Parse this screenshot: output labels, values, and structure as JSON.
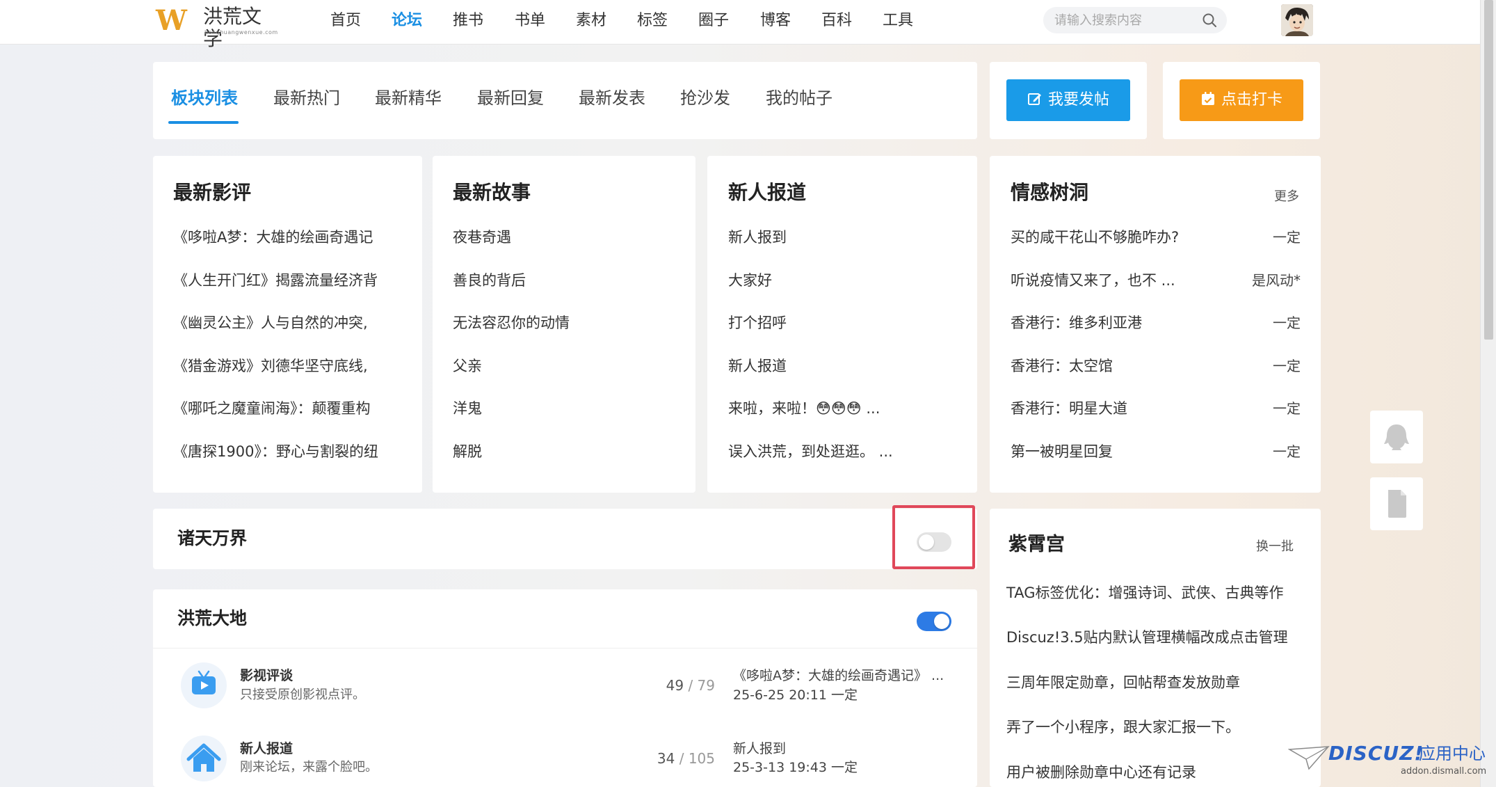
{
  "header": {
    "logo_mark": "W",
    "logo_name": "洪荒文学",
    "logo_sub": "honghuangwenxue.com",
    "nav": [
      "首页",
      "论坛",
      "推书",
      "书单",
      "素材",
      "标签",
      "圈子",
      "博客",
      "百科",
      "工具"
    ],
    "active_nav": "论坛",
    "search_placeholder": "请输入搜索内容"
  },
  "tabs": {
    "items": [
      "板块列表",
      "最新热门",
      "最新精华",
      "最新回复",
      "最新发表",
      "抢沙发",
      "我的帖子"
    ],
    "active": "板块列表"
  },
  "actions": {
    "post_label": "我要发帖",
    "checkin_label": "点击打卡",
    "post_color": "#1a9be8",
    "checkin_color": "#f79a17"
  },
  "blocks": [
    {
      "title": "最新影评",
      "items": [
        "《哆啦A梦：大雄的绘画奇遇记",
        "《人生开门红》揭露流量经济背",
        "《幽灵公主》人与自然的冲突,",
        "《猎金游戏》刘德华坚守底线,",
        "《哪吒之魔童闹海》：颠覆重构",
        "《唐探1900》：野心与割裂的纽"
      ]
    },
    {
      "title": "最新故事",
      "items": [
        "夜巷奇遇",
        "善良的背后",
        "无法容忍你的动情",
        "父亲",
        "洋鬼",
        "解脱"
      ]
    },
    {
      "title": "新人报道",
      "items": [
        "新人报到",
        "大家好",
        "打个招呼",
        "新人报道",
        "来啦，来啦！😳😳😳 ...",
        "误入洪荒，到处逛逛。 ..."
      ]
    },
    {
      "title": "情感树洞",
      "more": "更多",
      "items": [
        {
          "text": "买的咸干花山不够脆咋办?",
          "author": "一定"
        },
        {
          "text": "听说疫情又来了，也不 ...",
          "author": "是风动*"
        },
        {
          "text": "香港行：维多利亚港",
          "author": "一定"
        },
        {
          "text": "香港行：太空馆",
          "author": "一定"
        },
        {
          "text": "香港行：明星大道",
          "author": "一定"
        },
        {
          "text": "第一被明星回复",
          "author": "一定"
        }
      ]
    }
  ],
  "sections": [
    {
      "title": "诸天万界",
      "toggle_on": false
    },
    {
      "title": "洪荒大地",
      "toggle_on": true
    }
  ],
  "forums": [
    {
      "name": "影视评谈",
      "desc": "只接受原创影视点评。",
      "count": "49",
      "total": "79",
      "last_title": "《哆啦A梦：大雄的绘画奇遇记》 ...",
      "last_meta": "25-6-25 20:11 一定"
    },
    {
      "name": "新人报道",
      "desc": "刚来论坛，来露个脸吧。",
      "count": "34",
      "total": "105",
      "last_title": "新人报到",
      "last_meta": "25-3-13 19:43 一定"
    }
  ],
  "count_separator": "/",
  "sidebar": {
    "title": "紫霄宫",
    "refresh": "换一批",
    "items": [
      "TAG标签优化：增强诗词、武侠、古典等作",
      "Discuz!3.5贴内默认管理横幅改成点击管理",
      "三周年限定勋章，回帖帮查发放勋章",
      "弄了一个小程序，跟大家汇报一下。",
      "用户被删除勋章中心还有记录"
    ]
  },
  "watermark": {
    "brand": "DISCUZ!",
    "cn": "应用中心",
    "url": "addon.dismall.com"
  },
  "colors": {
    "accent": "#1a8fe3",
    "toggle_on": "#2d7be5",
    "toggle_off": "#e4e4e4",
    "highlight_border": "#e0485a"
  }
}
